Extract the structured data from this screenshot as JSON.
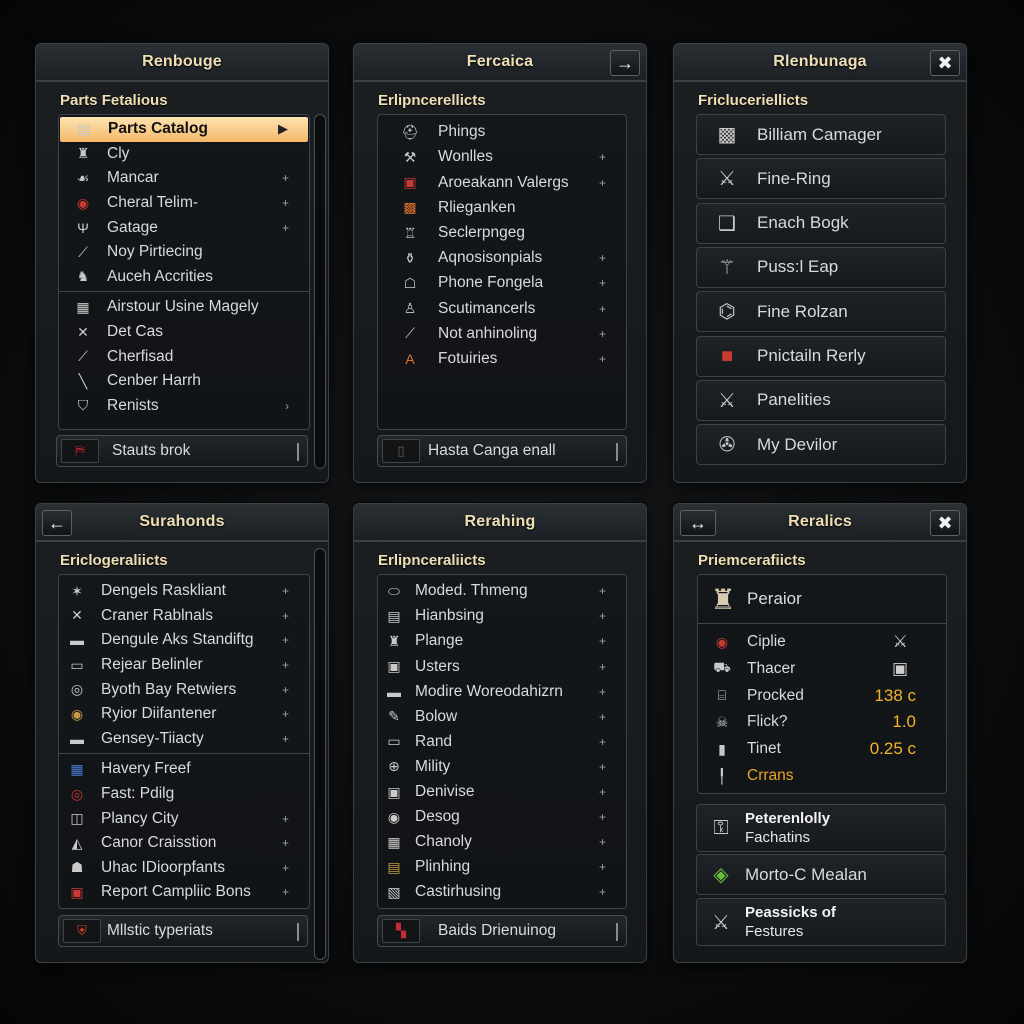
{
  "panels": [
    {
      "title": "Renbouge",
      "section": "Parts Fetalious",
      "items": [
        {
          "label": "Parts Catalog",
          "icon": "filing-cabinet-icon",
          "glyph": "▤",
          "trail": "▶",
          "selected": true
        },
        {
          "label": "Cly",
          "icon": "trophy-icon",
          "glyph": "♜",
          "trail": ""
        },
        {
          "label": "Mancar",
          "icon": "cat-icon",
          "glyph": "☙",
          "trail": "+"
        },
        {
          "label": "Cheral Telim-",
          "icon": "red-badge-icon",
          "glyph": "◉",
          "trail": "+"
        },
        {
          "label": "Gatage",
          "icon": "goblet-icon",
          "glyph": "Ψ",
          "trail": "+"
        },
        {
          "label": "Noy Pirtiecing",
          "icon": "wrench-icon",
          "glyph": "⟋",
          "trail": ""
        },
        {
          "label": "Auceh Accrities",
          "icon": "figure-icon",
          "glyph": "♞",
          "trail": ""
        },
        {
          "label": "Airstour Usine Magely",
          "icon": "map-icon",
          "glyph": "▦",
          "trail": ""
        },
        {
          "label": "Det Cas",
          "icon": "cross-icon",
          "glyph": "✕",
          "trail": ""
        },
        {
          "label": "Cherfisad",
          "icon": "knife-icon",
          "glyph": "⟋",
          "trail": ""
        },
        {
          "label": "Cenber Harrh",
          "icon": "staff-icon",
          "glyph": "╲",
          "trail": ""
        },
        {
          "label": "Renists",
          "icon": "shield-icon",
          "glyph": "⛉",
          "trail": "›"
        }
      ],
      "footer": {
        "label": "Stauts brok",
        "icon": "banner-icon",
        "glyph": "⛿"
      }
    },
    {
      "title": "Fercaica",
      "section": "Erlipncerellicts",
      "header_right": "→",
      "items": [
        {
          "label": "Phings",
          "icon": "helmet-icon",
          "glyph": "⛑",
          "trail": ""
        },
        {
          "label": "Wonlles",
          "icon": "hammer-icon",
          "glyph": "⚒",
          "trail": "+"
        },
        {
          "label": "Aroeakann Valergs",
          "icon": "red-box-icon",
          "glyph": "▣",
          "trail": "+"
        },
        {
          "label": "Rlieganken",
          "icon": "orange-box-icon",
          "glyph": "▩",
          "trail": ""
        },
        {
          "label": "Seclerpngeg",
          "icon": "tower-icon",
          "glyph": "♖",
          "trail": ""
        },
        {
          "label": "Aqnosisonpials",
          "icon": "vase-icon",
          "glyph": "⚱",
          "trail": "+"
        },
        {
          "label": "Phone Fongela",
          "icon": "pot-icon",
          "glyph": "☖",
          "trail": "+"
        },
        {
          "label": "Scutimancerls",
          "icon": "person-icon",
          "glyph": "♙",
          "trail": "+"
        },
        {
          "label": "Not anhinoling",
          "icon": "tool-icon",
          "glyph": "⟋",
          "trail": "+"
        },
        {
          "label": "Fotuiries",
          "icon": "letter-a-icon",
          "glyph": "A",
          "trail": "+"
        }
      ],
      "footer": {
        "label": "Hasta Canga enall",
        "icon": "frame-icon",
        "glyph": "▯"
      }
    },
    {
      "title": "Rlenbunaga",
      "section": "Fricluceriellicts",
      "header_right": "✖",
      "cards": [
        {
          "label": "Billiam Camager",
          "icon": "carpet-icon",
          "glyph": "▩"
        },
        {
          "label": "Fine-Ring",
          "icon": "axe-icon",
          "glyph": "⚔"
        },
        {
          "label": "Enach Bogk",
          "icon": "book-icon",
          "glyph": "❑"
        },
        {
          "label": "Puss:l Eap",
          "icon": "bundle-icon",
          "glyph": "⚚"
        },
        {
          "label": "Fine Rolzan",
          "icon": "scroll-icon",
          "glyph": "⌬"
        },
        {
          "label": "Pnictailn Rerly",
          "icon": "red-case-icon",
          "glyph": "■"
        },
        {
          "label": "Panelities",
          "icon": "crossed-swords-icon",
          "glyph": "⚔"
        },
        {
          "label": "My Devilor",
          "icon": "reel-icon",
          "glyph": "✇"
        }
      ]
    },
    {
      "title": "Surahonds",
      "section": "Ericlogeraliicts",
      "header_left": "←",
      "items": [
        {
          "label": "Dengels Raskliant",
          "icon": "star-icon",
          "glyph": "✶",
          "trail": "+"
        },
        {
          "label": "Craner Rablnals",
          "icon": "crossed-tools-icon",
          "glyph": "✕",
          "trail": "+"
        },
        {
          "label": "Dengule Aks Standiftg",
          "icon": "box-icon",
          "glyph": "▬",
          "trail": "+"
        },
        {
          "label": "Rejear Belinler",
          "icon": "paper-icon",
          "glyph": "▭",
          "trail": "+"
        },
        {
          "label": "Byoth Bay Retwiers",
          "icon": "globe-icon",
          "glyph": "◎",
          "trail": "+"
        },
        {
          "label": "Ryior Diifantener",
          "icon": "medallion-icon",
          "glyph": "◉",
          "trail": "+"
        },
        {
          "label": "Gensey-Tiiacty",
          "icon": "chest-icon",
          "glyph": "▬",
          "trail": "+"
        },
        {
          "label": "Havery Freef",
          "icon": "blue-tile-icon",
          "glyph": "▦",
          "trail": ""
        },
        {
          "label": "Fast: Pdilg",
          "icon": "red-swirl-icon",
          "glyph": "◎",
          "trail": ""
        },
        {
          "label": "Plancy City",
          "icon": "door-icon",
          "glyph": "◫",
          "trail": "+"
        },
        {
          "label": "Canor Craisstion",
          "icon": "tent-icon",
          "glyph": "◭",
          "trail": "+"
        },
        {
          "label": "Uhac IDioorpfants",
          "icon": "portrait-icon",
          "glyph": "☗",
          "trail": "+"
        },
        {
          "label": "Report Campliic Bons",
          "icon": "sigil-icon",
          "glyph": "▣",
          "trail": "+"
        }
      ],
      "footer": {
        "label": "Mllstic typeriats",
        "icon": "crest-icon",
        "glyph": "⛨"
      }
    },
    {
      "title": "Rerahing",
      "section": "Erlipnceraliicts",
      "items": [
        {
          "label": "Moded. Thmeng",
          "icon": "ring-icon",
          "glyph": "⬭",
          "trail": "+"
        },
        {
          "label": "Hianbsing",
          "icon": "chest-icon",
          "glyph": "▤",
          "trail": "+"
        },
        {
          "label": "Plange",
          "icon": "anvil-icon",
          "glyph": "♜",
          "trail": "+"
        },
        {
          "label": "Usters",
          "icon": "frame-icon",
          "glyph": "▣",
          "trail": "+"
        },
        {
          "label": "Modire Woreodahizrn",
          "icon": "crate-icon",
          "glyph": "▬",
          "trail": "+"
        },
        {
          "label": "Bolow",
          "icon": "quill-icon",
          "glyph": "✎",
          "trail": "+"
        },
        {
          "label": "Rand",
          "icon": "box-icon",
          "glyph": "▭",
          "trail": "+"
        },
        {
          "label": "Mility",
          "icon": "compass-icon",
          "glyph": "⊕",
          "trail": "+"
        },
        {
          "label": "Denivise",
          "icon": "portrait-icon",
          "glyph": "▣",
          "trail": "+"
        },
        {
          "label": "Desog",
          "icon": "disc-icon",
          "glyph": "◉",
          "trail": "+"
        },
        {
          "label": "Chanoly",
          "icon": "tile-icon",
          "glyph": "▦",
          "trail": "+"
        },
        {
          "label": "Plinhing",
          "icon": "gold-chest-icon",
          "glyph": "▤",
          "trail": "+"
        },
        {
          "label": "Castirhusing",
          "icon": "map-icon",
          "glyph": "▧",
          "trail": "+"
        }
      ],
      "footer": {
        "label": "Baids Drienuinog",
        "icon": "scroll-icon",
        "glyph": "▚"
      }
    },
    {
      "title": "Reralics",
      "section": "Priemcerafiicts",
      "header_left": "↔",
      "header_right": "✖",
      "featured": {
        "label": "Peraior",
        "icon": "tower-icon",
        "glyph": "♜"
      },
      "stats": [
        {
          "label": "Ciplie",
          "icon": "red-coin-icon",
          "glyph": "◉",
          "value": "",
          "value_icon": "crossed-swords-icon",
          "value_glyph": "⚔"
        },
        {
          "label": "Thacer",
          "icon": "cart-icon",
          "glyph": "⛟",
          "value": "",
          "value_icon": "chest-icon",
          "value_glyph": "▣"
        },
        {
          "label": "Procked",
          "icon": "anvil-icon",
          "glyph": "⌸",
          "value": "138 c"
        },
        {
          "label": "Flick?",
          "icon": "skull-icon",
          "glyph": "☠",
          "value": "1.0"
        },
        {
          "label": "Tinet",
          "icon": "door-icon",
          "glyph": "▮",
          "value": "0.25 c"
        },
        {
          "label": "Crrans",
          "icon": "pillar-icon",
          "glyph": "╿",
          "value": "",
          "gold": true
        }
      ],
      "cards": [
        {
          "title": "Peterenlolly",
          "subtitle": "Fachatins",
          "icon": "key-icon",
          "glyph": "⚿"
        },
        {
          "label": "Morto-C Mealan",
          "icon": "green-gem-icon",
          "glyph": "◈"
        },
        {
          "title": "Peassicks of",
          "subtitle": "Festures",
          "icon": "blade-icon",
          "glyph": "⚔"
        }
      ]
    }
  ],
  "colors": {
    "accent_gold": "#f1dfb4",
    "selected_bg": "#f5b86a",
    "value_orange": "#f0b429",
    "panel_bg": "#181b1e"
  }
}
